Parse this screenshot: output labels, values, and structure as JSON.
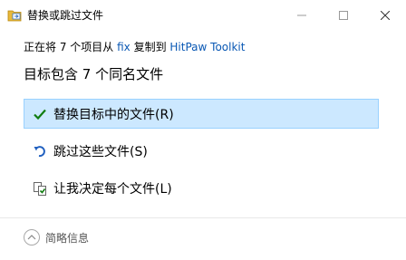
{
  "window": {
    "title": "替换或跳过文件",
    "icon": "file-copy-icon",
    "controls": [
      "minimize-icon",
      "maximize-icon",
      "close-icon"
    ]
  },
  "source_line": {
    "prefix": "正在将 7 个项目从 ",
    "source": "fix",
    "middle": " 复制到 ",
    "destination": "HitPaw Toolkit"
  },
  "heading": "目标包含 7 个同名文件",
  "options": [
    {
      "label": "替换目标中的文件(R)",
      "icon": "checkmark-icon",
      "selected": true
    },
    {
      "label": "跳过这些文件(S)",
      "icon": "skip-arrow-icon",
      "selected": false
    },
    {
      "label": "让我决定每个文件(L)",
      "icon": "compare-files-icon",
      "selected": false
    }
  ],
  "footer": {
    "toggle_label": "简略信息",
    "icon": "chevron-up-icon"
  },
  "colors": {
    "selection_bg": "#cce8ff",
    "selection_border": "#99d1ff",
    "link": "#0a58b4",
    "check": "#107c10",
    "skip_arrow": "#1f5fbf"
  }
}
